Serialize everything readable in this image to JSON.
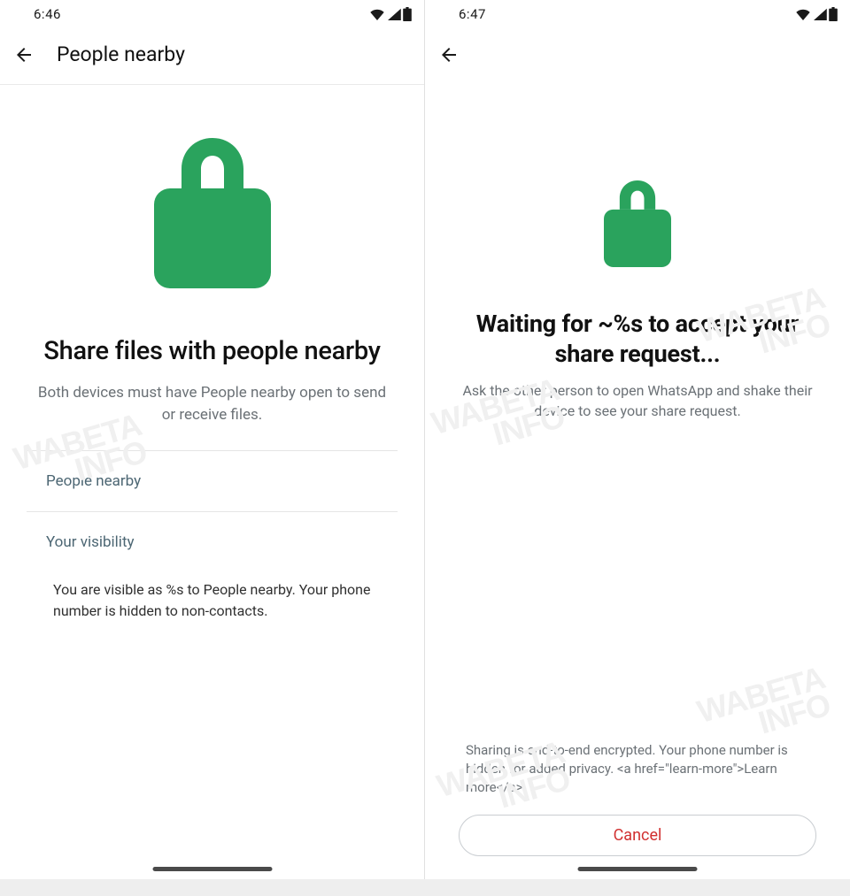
{
  "watermark": "WABETAINFO",
  "left": {
    "statusTime": "6:46",
    "appBarTitle": "People nearby",
    "headline": "Share files with people nearby",
    "subtext": "Both devices must have People nearby open to send or receive files.",
    "section1Title": "People nearby",
    "section2Title": "Your visibility",
    "section2Body": "You are visible as %s to People nearby. Your phone number is hidden to non-contacts."
  },
  "right": {
    "statusTime": "6:47",
    "headline": "Waiting for ~%s to accept your share request...",
    "subtext": "Ask the other person to open WhatsApp and shake their device to see your share request.",
    "privacyNote": "Sharing is end-to-end encrypted. Your phone number is hidden for added privacy. <a href=\"learn-more\">Learn more</a>",
    "cancelLabel": "Cancel"
  },
  "colors": {
    "lockGreen": "#2aa35d",
    "cancelRed": "#d13030",
    "sectionHead": "#4c6673"
  }
}
